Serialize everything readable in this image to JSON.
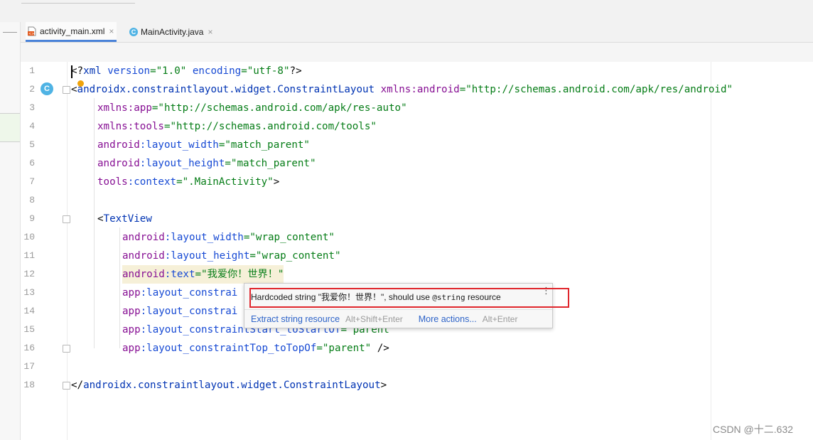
{
  "tabs": [
    {
      "label": "activity_main.xml",
      "icon": "xml-file-icon",
      "active": true
    },
    {
      "label": "MainActivity.java",
      "icon": "java-class-icon",
      "active": false
    }
  ],
  "close_glyph": "×",
  "gutter_badge": "C",
  "code_lines": [
    {
      "n": "1"
    },
    {
      "n": "2"
    },
    {
      "n": "3"
    },
    {
      "n": "4"
    },
    {
      "n": "5"
    },
    {
      "n": "6"
    },
    {
      "n": "7"
    },
    {
      "n": "8"
    },
    {
      "n": "9"
    },
    {
      "n": "10"
    },
    {
      "n": "11"
    },
    {
      "n": "12"
    },
    {
      "n": "13"
    },
    {
      "n": "14"
    },
    {
      "n": "15"
    },
    {
      "n": "16"
    },
    {
      "n": "17"
    },
    {
      "n": "18"
    }
  ],
  "code": {
    "l1": {
      "open": "<?",
      "tag": "xml",
      "a1": " version",
      "v1": "=\"1.0\"",
      "a2": " encoding",
      "v2": "=\"utf-8\"",
      "close": "?>"
    },
    "l2": {
      "open": "<",
      "tag": "androidx.constraintlayout.widget.ConstraintLayout",
      "ns": " xmlns:android",
      "val": "=\"http://schemas.android.com/apk/res/android\""
    },
    "l3": {
      "ns": "xmlns:app",
      "val": "=\"http://schemas.android.com/apk/res-auto\""
    },
    "l4": {
      "ns": "xmlns:tools",
      "val": "=\"http://schemas.android.com/tools\""
    },
    "l5": {
      "ns": "android",
      "attr": ":layout_width",
      "val": "=\"match_parent\""
    },
    "l6": {
      "ns": "android",
      "attr": ":layout_height",
      "val": "=\"match_parent\""
    },
    "l7": {
      "ns": "tools",
      "attr": ":context",
      "val": "=\".MainActivity\"",
      "close": ">"
    },
    "l9": {
      "open": "<",
      "tag": "TextView"
    },
    "l10": {
      "ns": "android",
      "attr": ":layout_width",
      "val": "=\"wrap_content\""
    },
    "l11": {
      "ns": "android",
      "attr": ":layout_height",
      "val": "=\"wrap_content\""
    },
    "l12": {
      "ns": "android",
      "attr": ":text",
      "val": "=\"我爱你！世界！\""
    },
    "l13": {
      "ns": "app",
      "attr": ":layout_constrai"
    },
    "l14": {
      "ns": "app",
      "attr": ":layout_constrai"
    },
    "l15": {
      "ns": "app",
      "attr": ":layout_constraintStart_toStartOf",
      "val": "=\"parent\""
    },
    "l16": {
      "ns": "app",
      "attr": ":layout_constraintTop_toTopOf",
      "val": "=\"parent\"",
      "close": " />"
    },
    "l18": {
      "open": "</",
      "tag": "androidx.constraintlayout.widget.ConstraintLayout",
      "close": ">"
    }
  },
  "popup": {
    "message_pre": "Hardcoded string \"我爱你！世界！\", should use ",
    "message_mono": "@string",
    "message_post": " resource",
    "kebab": "⋮",
    "action1": "Extract string resource",
    "action1_key": "Alt+Shift+Enter",
    "action2": "More actions...",
    "action2_key": "Alt+Enter"
  },
  "watermark": "CSDN @十二.632",
  "colors": {
    "tag": "#0033b3",
    "namespace": "#871094",
    "attribute": "#174ad4",
    "value": "#067d17",
    "highlight": "#e0262c"
  }
}
